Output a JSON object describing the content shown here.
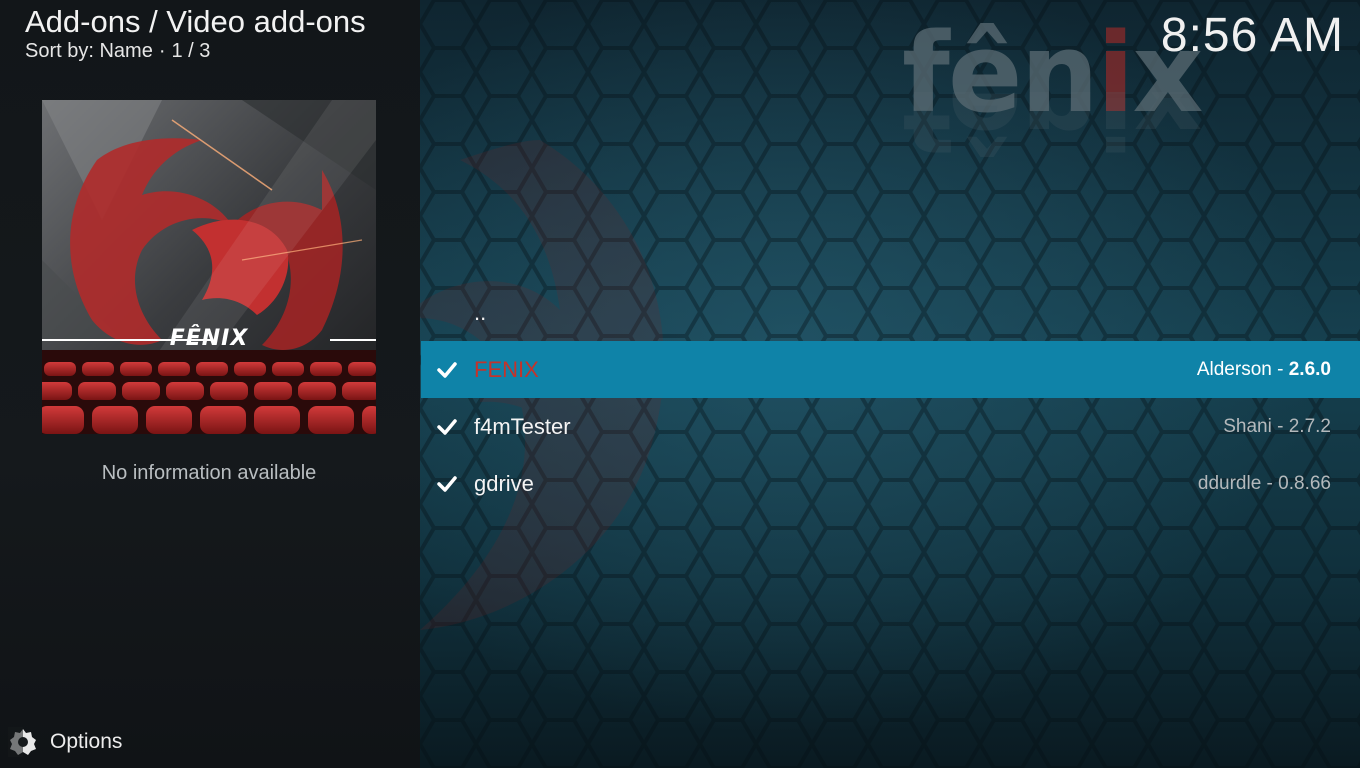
{
  "header": {
    "title": "Add-ons / Video add-ons",
    "sort_label": "Sort by: Name",
    "separator": "·",
    "page": "1 / 3"
  },
  "clock": "8:56 AM",
  "backdrop": {
    "logo_text_pre": "fên",
    "logo_text_accent": "i",
    "logo_text_post": "x"
  },
  "thumbnail": {
    "label": "FÊNIX"
  },
  "info": "No information available",
  "options": {
    "label": "Options",
    "icon": "options-gear-icon"
  },
  "list": {
    "parent": "..",
    "items": [
      {
        "name": "FENIX",
        "author": "Alderson",
        "sep": " - ",
        "version": "2.6.0",
        "installed": true,
        "selected": true
      },
      {
        "name": "f4mTester",
        "author": "Shani",
        "sep": " - ",
        "version": "2.7.2",
        "installed": true,
        "selected": false
      },
      {
        "name": "gdrive",
        "author": "ddurdle",
        "sep": " - ",
        "version": "0.8.66",
        "installed": true,
        "selected": false
      }
    ]
  },
  "colors": {
    "selection": "#0f83a8",
    "selected_name": "#c4332b"
  }
}
